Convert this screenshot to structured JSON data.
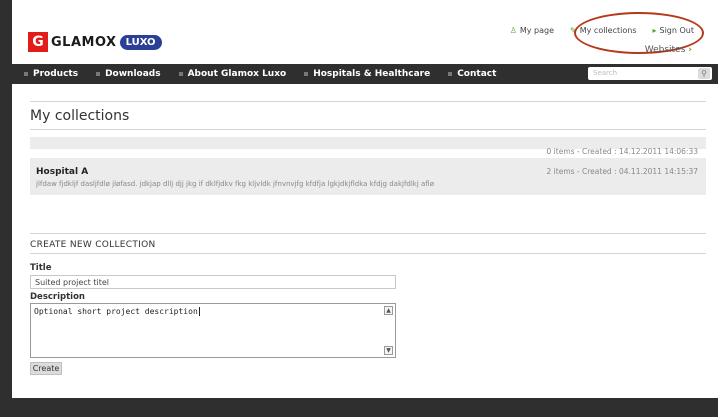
{
  "brand": {
    "logo_g": "G",
    "logo_text": "GLAMOX",
    "logo_luxo": "LUXO"
  },
  "top_nav": {
    "my_page": "My page",
    "my_collections": "My collections",
    "sign_out": "Sign Out",
    "websites": "Websites",
    "websites_arrow": "›"
  },
  "main_nav": {
    "items": [
      "Products",
      "Downloads",
      "About Glamox Luxo",
      "Hospitals & Healthcare",
      "Contact"
    ],
    "search_placeholder": "Search",
    "search_icon_glyph": "⚲"
  },
  "page": {
    "title": "My collections"
  },
  "collections": [
    {
      "name": "",
      "meta": "0 items - Created : 14.12.2011 14:06:33",
      "description": ""
    },
    {
      "name": "Hospital A",
      "meta": "2 items - Created : 04.11.2011 14:15:37",
      "description": "jlfdaw fjdkljf dasljfdlø jløfasd. jdkjap dllj djj jkg if dklfjdkv fkg kljvldk jfnvnvjfg kfdfja lgkjdkjfldka kfdjg dakjfdlkj aflø"
    }
  ],
  "create_form": {
    "section_title": "CREATE NEW COLLECTION",
    "title_label": "Title",
    "title_value": "Suited project titel",
    "description_label": "Description",
    "description_value": "Optional short project description",
    "create_button": "Create",
    "scroll_up": "▲",
    "scroll_down": "▼"
  },
  "colors": {
    "accent_green": "#5aa02c",
    "nav_bg": "#2f2f2f",
    "brand_red": "#e21b1b",
    "brand_blue": "#2b3f97",
    "annotation_oval": "#b53a1a"
  }
}
